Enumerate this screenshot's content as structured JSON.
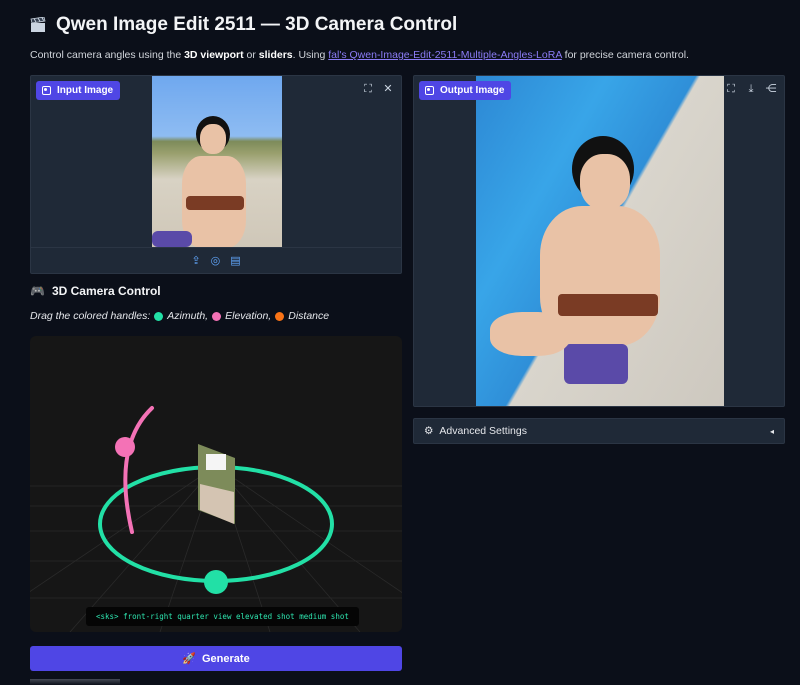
{
  "header": {
    "title": "Qwen Image Edit 2511 — 3D Camera Control",
    "subtitle": {
      "part1": "Control camera angles using the ",
      "bold1": "3D viewport",
      "part2": " or ",
      "bold2": "sliders",
      "part3": ". Using ",
      "link": "fal's Qwen-Image-Edit-2511-Multiple-Angles-LoRA",
      "part4": " for precise camera control."
    }
  },
  "input_panel": {
    "badge": "Input Image"
  },
  "output_panel": {
    "badge": "Output Image"
  },
  "camera_control": {
    "title": "3D Camera Control",
    "hint_prefix": "Drag the colored handles:",
    "azimuth": "Azimuth,",
    "elevation": "Elevation,",
    "distance": "Distance",
    "prompt": "<sks> front-right quarter view elevated shot medium shot",
    "colors": {
      "azimuth": "#22e0a6",
      "elevation": "#f472b6",
      "distance": "#f97316"
    }
  },
  "generate_button": "Generate",
  "advanced_settings": "Advanced Settings",
  "icons": {
    "clapper": "clapper-board-icon",
    "game": "gamepad-icon",
    "rocket": "rocket-icon",
    "gear": "gear-icon"
  }
}
